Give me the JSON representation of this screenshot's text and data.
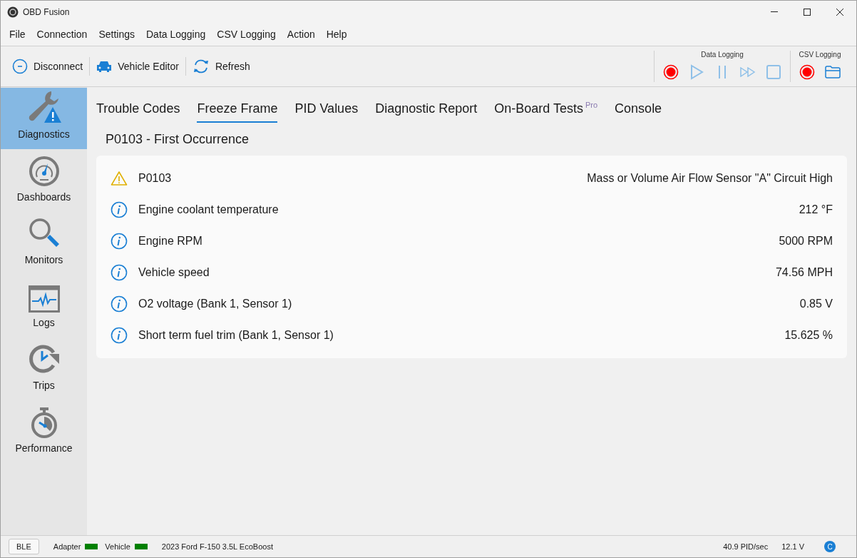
{
  "window": {
    "title": "OBD Fusion"
  },
  "menu": [
    "File",
    "Connection",
    "Settings",
    "Data Logging",
    "CSV Logging",
    "Action",
    "Help"
  ],
  "toolbar": [
    {
      "kind": "disconnect",
      "label": "Disconnect"
    },
    {
      "kind": "vehicle",
      "label": "Vehicle Editor"
    },
    {
      "kind": "refresh",
      "label": "Refresh"
    }
  ],
  "logging_groups": [
    {
      "title": "Data Logging",
      "buttons": [
        {
          "kind": "record",
          "disabled": false
        },
        {
          "kind": "play",
          "disabled": true
        },
        {
          "kind": "pause",
          "disabled": true
        },
        {
          "kind": "forward",
          "disabled": true
        },
        {
          "kind": "stop",
          "disabled": true
        }
      ]
    },
    {
      "title": "CSV Logging",
      "buttons": [
        {
          "kind": "record",
          "disabled": false
        },
        {
          "kind": "folder",
          "disabled": false
        }
      ]
    }
  ],
  "sidebar": {
    "items": [
      {
        "kind": "diagnostics",
        "label": "Diagnostics",
        "selected": true
      },
      {
        "kind": "dashboards",
        "label": "Dashboards",
        "selected": false
      },
      {
        "kind": "monitors",
        "label": "Monitors",
        "selected": false
      },
      {
        "kind": "logs",
        "label": "Logs",
        "selected": false
      },
      {
        "kind": "trips",
        "label": "Trips",
        "selected": false
      },
      {
        "kind": "performance",
        "label": "Performance",
        "selected": false
      }
    ]
  },
  "tabs": [
    {
      "label": "Trouble Codes",
      "selected": false
    },
    {
      "label": "Freeze Frame",
      "selected": true
    },
    {
      "label": "PID Values",
      "selected": false
    },
    {
      "label": "Diagnostic Report",
      "selected": false
    },
    {
      "label": "On-Board Tests",
      "badge": "Pro",
      "selected": false
    },
    {
      "label": "Console",
      "selected": false
    }
  ],
  "section_title": "P0103 - First Occurrence",
  "rows": [
    {
      "kind": "warning",
      "label": "P0103",
      "value": "Mass or Volume Air Flow Sensor \"A\" Circuit High"
    },
    {
      "kind": "info",
      "label": "Engine coolant temperature",
      "value": "212 °F"
    },
    {
      "kind": "info",
      "label": "Engine RPM",
      "value": "5000 RPM"
    },
    {
      "kind": "info",
      "label": "Vehicle speed",
      "value": "74.56 MPH"
    },
    {
      "kind": "info",
      "label": "O2 voltage (Bank 1, Sensor 1)",
      "value": "0.85 V"
    },
    {
      "kind": "info",
      "label": "Short term fuel trim (Bank 1, Sensor 1)",
      "value": "15.625 %"
    }
  ],
  "status_bar": {
    "connection": "BLE",
    "indicators": [
      {
        "label": "Adapter",
        "color": "#008000"
      },
      {
        "label": "Vehicle",
        "color": "#008000"
      }
    ],
    "vehicle": "2023 Ford F-150 3.5L EcoBoost",
    "rate": "40.9 PID/sec",
    "voltage": "12.1 V",
    "badge": "C"
  }
}
